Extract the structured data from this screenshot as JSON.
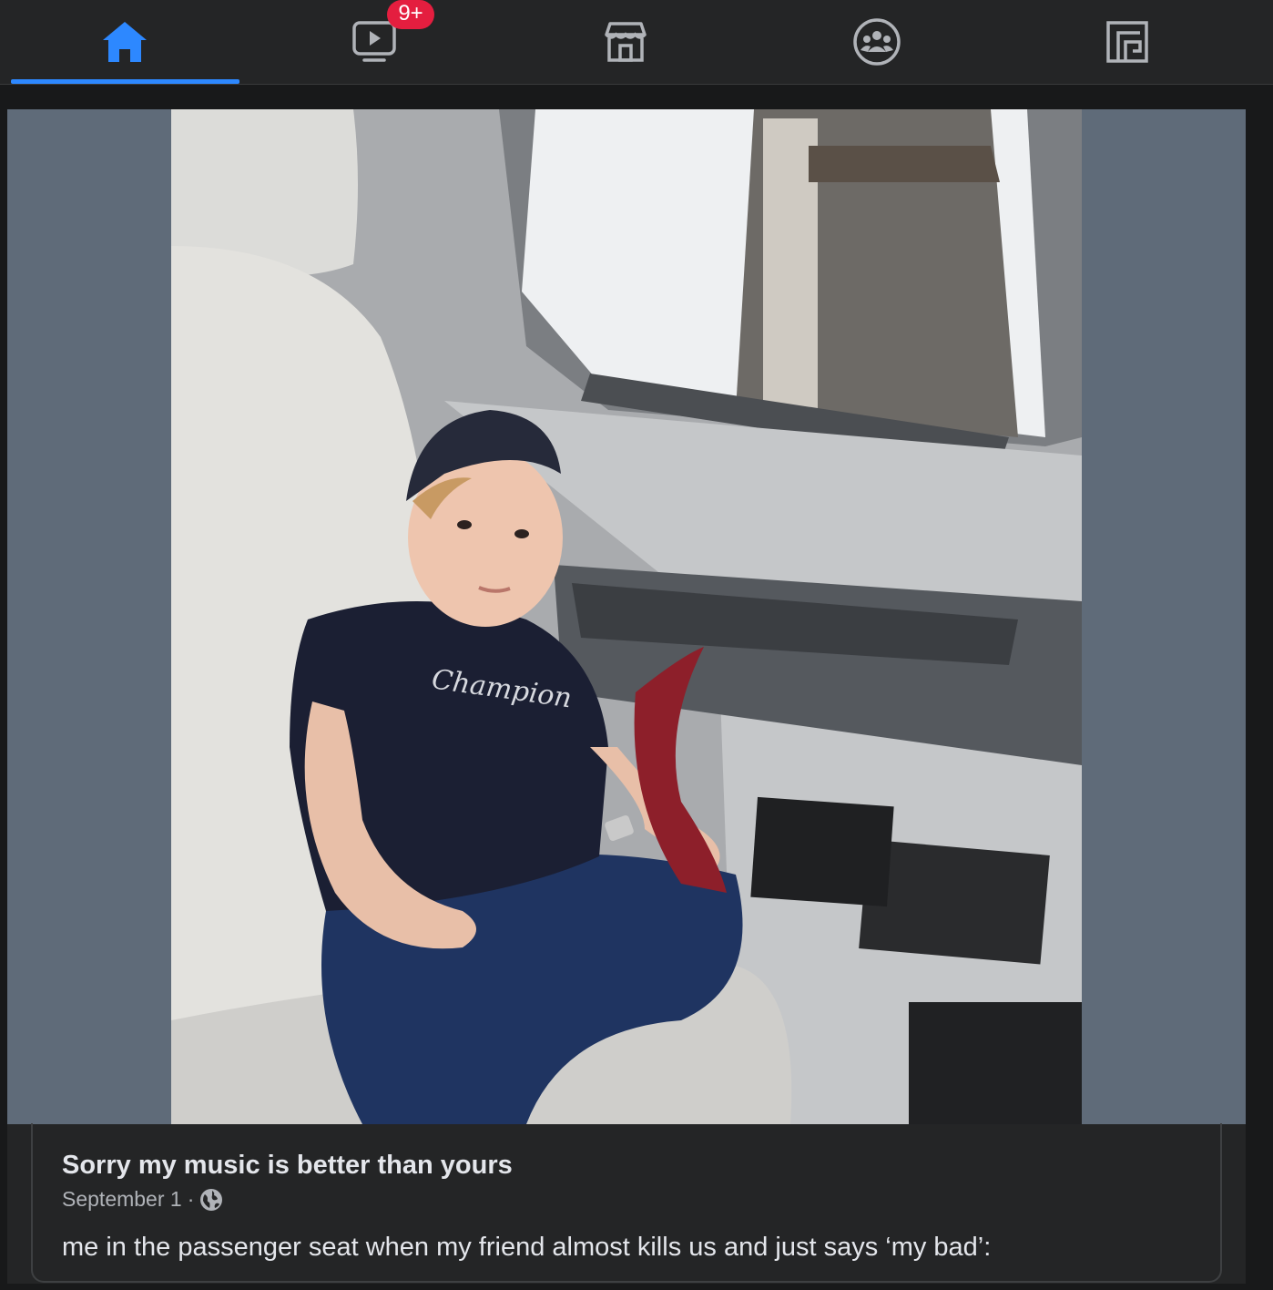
{
  "nav": {
    "tabs": [
      {
        "name": "home",
        "icon": "home-icon",
        "active": true
      },
      {
        "name": "watch",
        "icon": "video-icon",
        "badge": "9+"
      },
      {
        "name": "marketplace",
        "icon": "store-icon"
      },
      {
        "name": "groups",
        "icon": "groups-icon"
      },
      {
        "name": "gaming",
        "icon": "gaming-icon"
      }
    ],
    "watch_badge": "9+"
  },
  "post": {
    "image_icon": "photo-of-child-in-car-seat",
    "title": "Sorry my music is better than yours",
    "date": "September 1",
    "separator": "·",
    "privacy_icon": "globe-icon",
    "caption": "me in the passenger seat when my friend almost kills us and just says ‘my bad’:"
  },
  "colors": {
    "accent": "#2d88ff",
    "badge": "#e41e3f",
    "background": "#18191a",
    "card": "#242526",
    "media_letterbox": "#5f6b79"
  }
}
